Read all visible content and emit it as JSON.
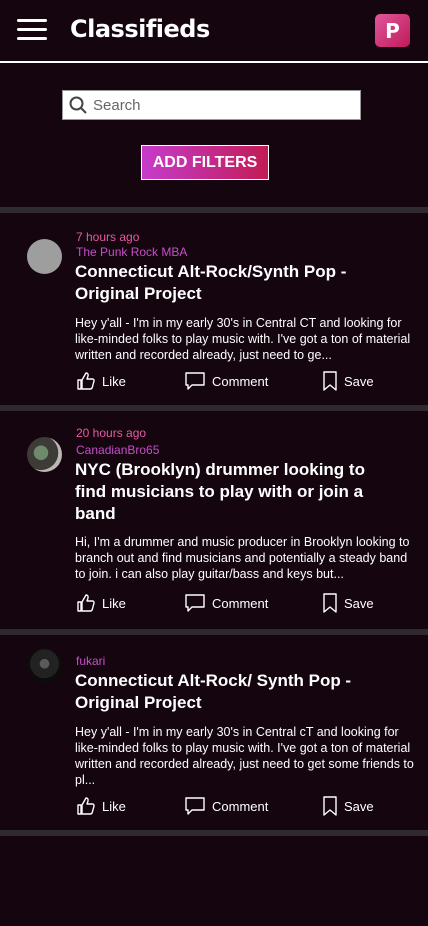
{
  "app": {
    "title": "Classifieds",
    "profile_initial": "P"
  },
  "search": {
    "placeholder": "Search",
    "value": ""
  },
  "filters": {
    "label": "ADD FILTERS"
  },
  "actions": {
    "like": "Like",
    "comment": "Comment",
    "save": "Save"
  },
  "posts": [
    {
      "time": "7 hours ago",
      "author": "The Punk Rock MBA",
      "title": "Connecticut Alt-Rock/Synth Pop - Original Project",
      "body": "Hey y'all - I'm in my early 30's in Central CT and looking for like-minded folks to play music with. I've got a ton of material written and recorded already, just need to ge..."
    },
    {
      "time": "20 hours ago",
      "author": "CanadianBro65",
      "title": "NYC (Brooklyn) drummer looking to find musicians to play with or join a band",
      "body": "Hi, I'm a drummer and music producer in Brooklyn looking to branch out and find musicians and potentially a steady band to join. i can also play guitar/bass and keys but..."
    },
    {
      "time": "",
      "author": "fukari",
      "title": "Connecticut Alt-Rock/ Synth Pop - Original Project",
      "body": "Hey y'all - I'm in my early 30's in Central cT and looking for like-minded folks to play music with. I've got a ton of material written and recorded already, just need to get some friends to pl..."
    }
  ],
  "colors": {
    "background": "#14050f",
    "accent_pink": "#e45ca0",
    "accent_purple": "#c54fc9",
    "divider": "#2e2a2d"
  }
}
